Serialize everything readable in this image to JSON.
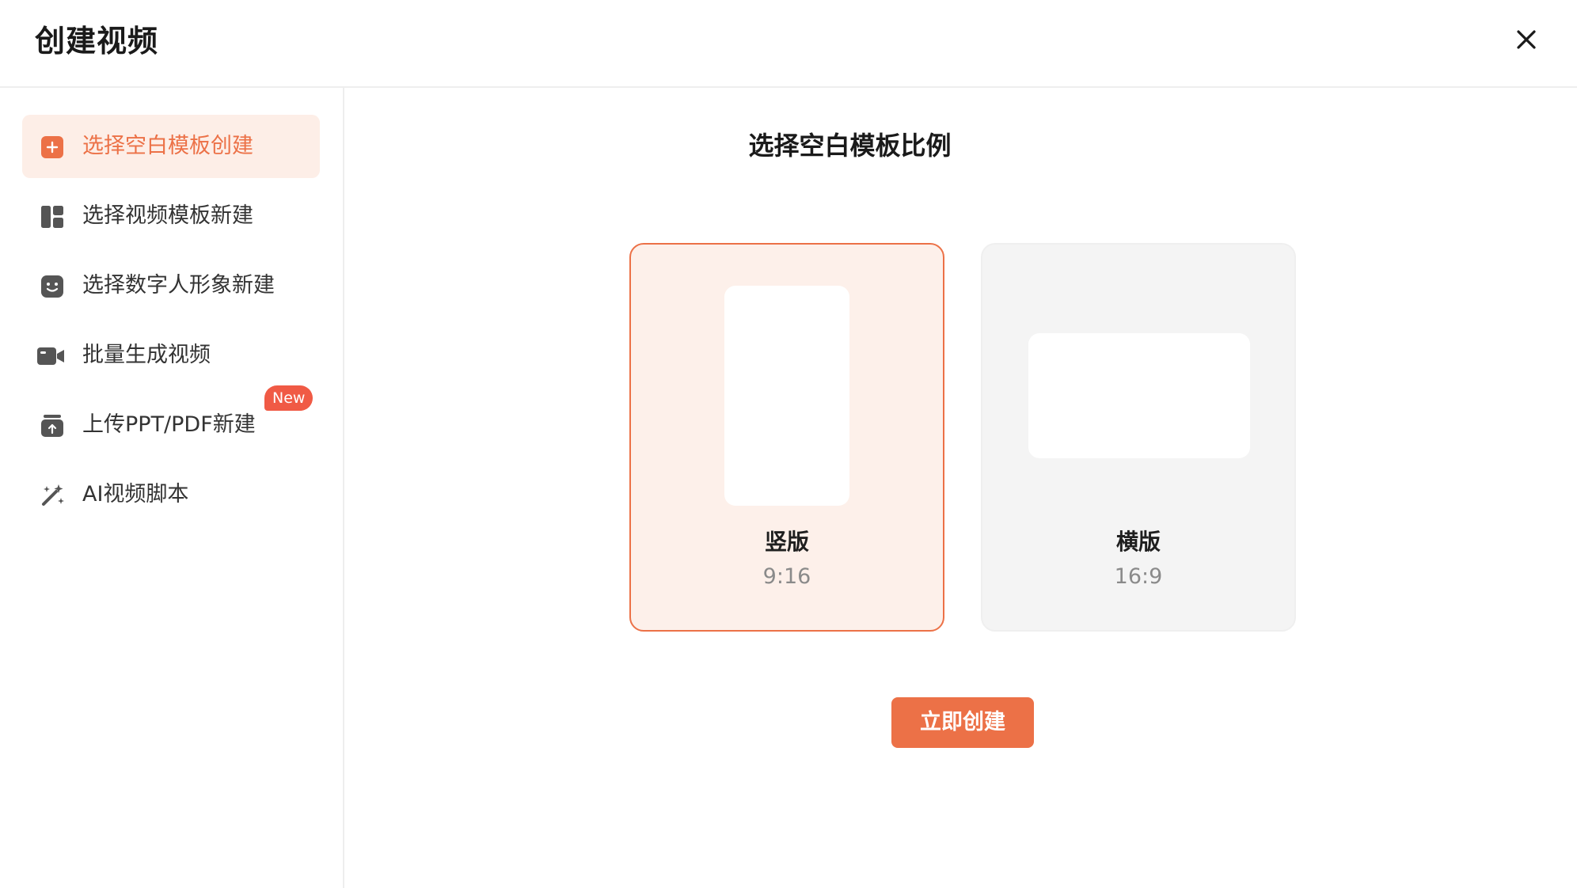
{
  "header": {
    "title": "创建视频"
  },
  "sidebar": {
    "items": [
      {
        "label": "选择空白模板创建",
        "icon": "add-square-icon",
        "active": true
      },
      {
        "label": "选择视频模板新建",
        "icon": "template-layout-icon",
        "active": false
      },
      {
        "label": "选择数字人形象新建",
        "icon": "smile-face-icon",
        "active": false
      },
      {
        "label": "批量生成视频",
        "icon": "video-camera-icon",
        "active": false
      },
      {
        "label": "上传PPT/PDF新建",
        "icon": "upload-box-icon",
        "active": false,
        "badge": "New"
      },
      {
        "label": "AI视频脚本",
        "icon": "magic-wand-icon",
        "active": false
      }
    ]
  },
  "main": {
    "title": "选择空白模板比例",
    "options": [
      {
        "name": "竖版",
        "ratio": "9:16",
        "selected": true
      },
      {
        "name": "横版",
        "ratio": "16:9",
        "selected": false
      }
    ],
    "create_label": "立即创建"
  },
  "colors": {
    "accent": "#ec7147",
    "accent_bg": "#fdeee7",
    "badge": "#f05a45",
    "icon": "#555555"
  }
}
